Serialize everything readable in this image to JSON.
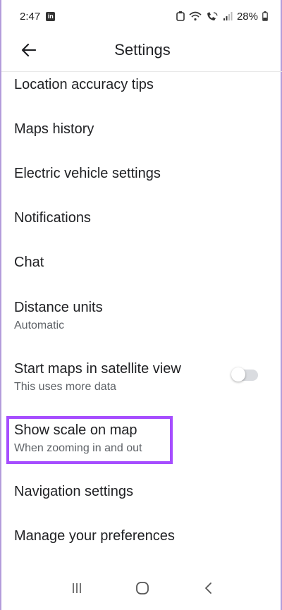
{
  "status_bar": {
    "time": "2:47",
    "battery": "28%"
  },
  "app_bar": {
    "title": "Settings"
  },
  "items": [
    {
      "title": "Location accuracy tips"
    },
    {
      "title": "Maps history"
    },
    {
      "title": "Electric vehicle settings"
    },
    {
      "title": "Notifications"
    },
    {
      "title": "Chat"
    },
    {
      "title": "Distance units",
      "subtitle": "Automatic"
    },
    {
      "title": "Start maps in satellite view",
      "subtitle": "This uses more data",
      "toggle_on": false
    },
    {
      "title": "Show scale on map",
      "subtitle": "When zooming in and out"
    },
    {
      "title": "Navigation settings"
    },
    {
      "title": "Manage your preferences"
    }
  ],
  "colors": {
    "highlight": "#a64dff",
    "frame_border": "#b39ddb"
  },
  "icons": [
    "linkedin-icon",
    "notification-icon",
    "wifi-icon",
    "wifi-calling-icon",
    "signal-icon",
    "battery-icon",
    "back-arrow-icon",
    "recents-icon",
    "home-icon",
    "nav-back-icon"
  ]
}
